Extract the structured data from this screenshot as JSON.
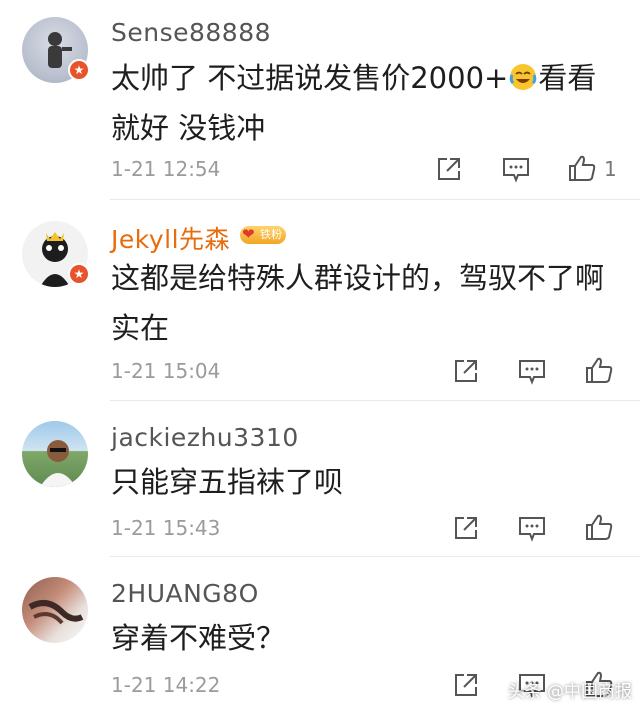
{
  "comments": [
    {
      "username": "Sense88888",
      "text": "太帅了 不过据说发售价2000+",
      "emoji": "laugh-cry-emoji",
      "text_after_emoji": "看看就好 没钱冲",
      "time": "1-21 12:54",
      "likes": "1",
      "verified": true
    },
    {
      "username": "Jekyll先森",
      "fan_badge": "铁粉",
      "text": "这都是给特殊人群设计的，驾驭不了啊实在",
      "time": "1-21 15:04",
      "verified": true
    },
    {
      "username": "jackiezhu3310",
      "text": "只能穿五指袜了呗",
      "time": "1-21 15:43"
    },
    {
      "username": "2HUANG8O",
      "text": "穿着不难受？",
      "time": "1-21 14:22"
    }
  ],
  "watermark": "头条 @中国商报",
  "colors": {
    "vip_name": "#e86b0c",
    "muted": "#9b9b9b",
    "badge_red": "#e8532b"
  },
  "icons": {
    "share": "share-icon",
    "comment": "comment-icon",
    "like": "thumbs-up-icon"
  }
}
